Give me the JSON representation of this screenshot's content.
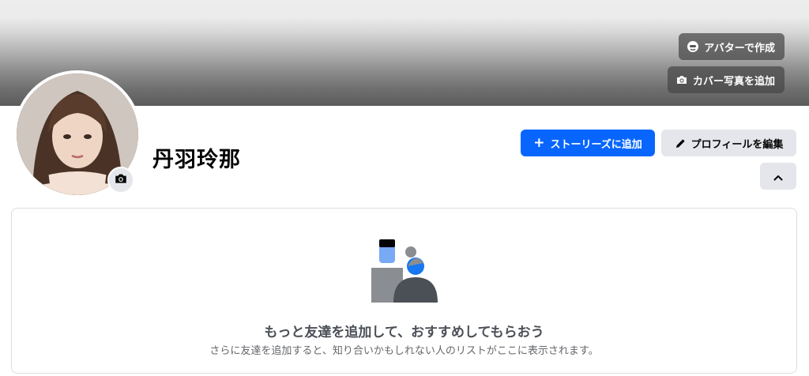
{
  "cover": {
    "avatar_button_label": "アバターで作成",
    "add_cover_button_label": "カバー写真を追加"
  },
  "profile": {
    "name": "丹羽玲那"
  },
  "actions": {
    "add_story_label": "ストーリーズに追加",
    "add_story_icon": "plus-icon",
    "edit_profile_label": "プロフィールを編集",
    "edit_profile_icon": "pencil-icon",
    "collapse_icon": "chevron-up-icon"
  },
  "friends_suggestion": {
    "title": "もっと友達を追加して、おすすめしてもらおう",
    "subtitle": "さらに友達を追加すると、知り合いかもしれない人のリストがここに表示されます。"
  },
  "colors": {
    "primary": "#0866ff",
    "secondary_button": "#e4e6eb"
  }
}
